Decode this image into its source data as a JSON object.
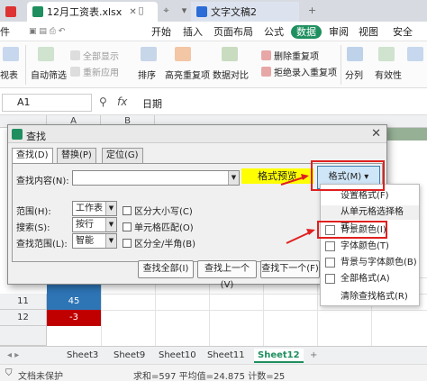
{
  "titlebar": {
    "tabs": [
      {
        "label": "12月工资表.xlsx",
        "icon": "spreadsheet-icon",
        "color": "#1f8f5f"
      },
      {
        "label": "文字文稿2",
        "icon": "document-icon",
        "color": "#2b6cd6"
      }
    ]
  },
  "menu": {
    "items": [
      "件",
      "开始",
      "插入",
      "页面布局",
      "公式",
      "数据",
      "审阅",
      "视图",
      "安全"
    ],
    "active": "数据"
  },
  "ribbon": {
    "perspective_label": "视表",
    "autofilter_label": "自动筛选",
    "show_all_label": "全部显示",
    "reapply_label": "重新应用",
    "sort_label": "排序",
    "highlight_dup_label": "高亮重复项",
    "data_compare_label": "数据对比",
    "delete_dup_label": "删除重复项",
    "reject_dup_label": "拒绝录入重复项",
    "split_label": "分列",
    "valid_label": "有效性"
  },
  "formula": {
    "cell_ref": "A1",
    "fx_label": "fx",
    "content": "日期"
  },
  "grid": {
    "columns": [
      "A",
      "B"
    ],
    "rows": [
      {
        "num": "11",
        "value": "45",
        "color": "#2e75b6"
      },
      {
        "num": "12",
        "value": "-3",
        "color": "#c00000"
      }
    ]
  },
  "dialog": {
    "title": "查找",
    "tabs": [
      "查找(D)",
      "替换(P)",
      "定位(G)"
    ],
    "find_label": "查找内容(N):",
    "find_value": "",
    "format_preview": "格式预览",
    "format_button": "格式(M)",
    "scope_label": "范围(H):",
    "scope_value": "工作表",
    "search_label": "搜索(S):",
    "search_value": "按行",
    "look_in_label": "查找范围(L):",
    "look_in_value": "智能",
    "match_case": "区分大小写(C)",
    "match_cell": "单元格匹配(O)",
    "match_width": "区分全/半角(B)",
    "find_all": "查找全部(I)",
    "find_prev": "查找上一个(V)",
    "find_next": "查找下一个(F)"
  },
  "format_menu": {
    "set_format": "设置格式(F)",
    "from_cell_header": "从单元格选择格式：",
    "bg_color": "背景颜色(I)",
    "font_color": "字体颜色(T)",
    "bg_font_color": "背景与字体颜色(B)",
    "all_format": "全部格式(A)",
    "clear_format": "清除查找格式(R)"
  },
  "sheets": [
    "Sheet3",
    "Sheet9",
    "Sheet10",
    "Sheet11",
    "Sheet12"
  ],
  "active_sheet": "Sheet12",
  "status": {
    "protect": "文档未保护",
    "stats": "求和=597  平均值=24.875  计数=25"
  },
  "colors": {
    "accent": "#1f8f5f",
    "annotation": "#e02020",
    "highlight": "#ffff00"
  }
}
